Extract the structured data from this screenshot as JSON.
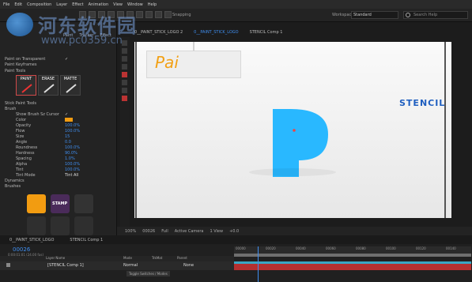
{
  "menubar": [
    "File",
    "Edit",
    "Composition",
    "Layer",
    "Effect",
    "Animation",
    "View",
    "Window",
    "Help"
  ],
  "toolbar": {
    "snapping": "Snapping",
    "workspace_label": "Workspace:",
    "workspace_value": "Standard",
    "search_placeholder": "Search Help"
  },
  "watermark": {
    "line1": "河东软件园",
    "line2": "www.pc0359.cn"
  },
  "left_panel": {
    "tabs": [
      "Paint",
      "Tracker",
      "Effect"
    ],
    "rows": [
      {
        "label": "Paint on Transparent",
        "value": "✓"
      },
      {
        "label": "Paint Keyframes",
        "value": ""
      },
      {
        "label": "Paint Tools",
        "value": ""
      }
    ],
    "tool_buttons": [
      "PAINT",
      "ERASE",
      "MATTE"
    ],
    "brush_section": "Stick Paint Tools",
    "brush_label": "Brush",
    "props": [
      {
        "label": "Show Brush Sz Cursor",
        "value": "✓"
      },
      {
        "label": "Color",
        "value": ""
      },
      {
        "label": "Opacity",
        "value": "100.0%"
      },
      {
        "label": "Flow",
        "value": "100.0%"
      },
      {
        "label": "Size",
        "value": "15"
      },
      {
        "label": "Angle",
        "value": "0.0"
      },
      {
        "label": "Roundness",
        "value": "100.0%"
      },
      {
        "label": "Hardness",
        "value": "90.0%"
      },
      {
        "label": "Spacing",
        "value": "1.0%"
      },
      {
        "label": "Alpha",
        "value": "100.0%"
      },
      {
        "label": "Tint",
        "value": "100.0%"
      },
      {
        "label": "Tint Mode",
        "value": "Tint All"
      }
    ],
    "sections": [
      "Dynamics",
      "Brushes"
    ],
    "stamp_label": "STAMP"
  },
  "comp_tabs": [
    "0__PAINT_STICK_LOGO 2",
    "0__PAINT_STICK_LOGO",
    "STENCIL Comp 1"
  ],
  "canvas": {
    "pai_text": "Pai",
    "stencil_text": "STENCIL",
    "p_color": "#29b8ff"
  },
  "viewer_bar": {
    "zoom": "100%",
    "time": "00026",
    "res": "Full",
    "camera": "Active Camera",
    "views": "1 View",
    "exposure": "+0.0"
  },
  "timeline_tabs": [
    "0__PAINT_STICK_LOGO",
    "STENCIL Comp 1"
  ],
  "timeline": {
    "timecode": "00026",
    "timecode_sub": "0:00:01:01 (24.00 fps)",
    "col_headers": [
      "Layer Name",
      "Mode",
      "TrkMat",
      "Parent"
    ],
    "layer_name": "[STENCIL Comp 1]",
    "layer_mode": "Normal",
    "layer_parent": "None",
    "ticks": [
      "00000",
      "00020",
      "00040",
      "00060",
      "00080",
      "00100",
      "00120",
      "00140"
    ],
    "toggle_label": "Toggle Switches / Modes"
  }
}
